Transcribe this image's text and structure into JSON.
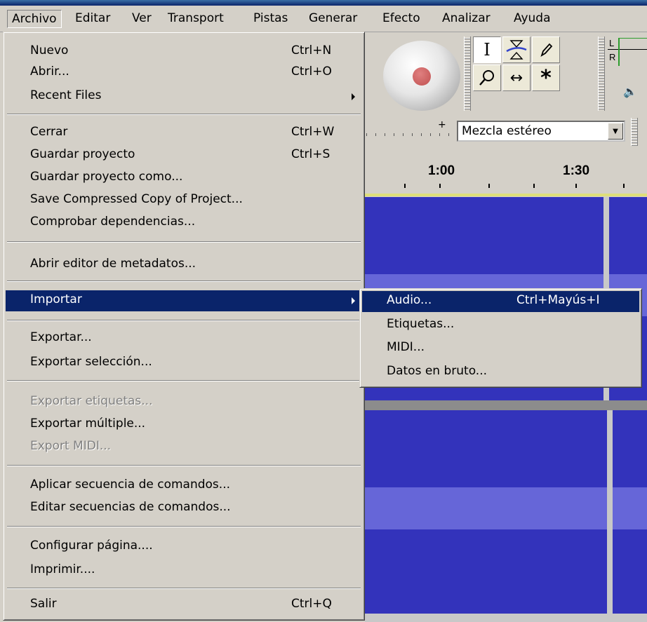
{
  "menubar": {
    "items": [
      "Archivo",
      "Editar",
      "Ver",
      "Transport",
      "Pistas",
      "Generar",
      "Efecto",
      "Analizar",
      "Ayuda"
    ]
  },
  "file_menu": {
    "items": [
      {
        "label": "Nuevo",
        "shortcut": "Ctrl+N"
      },
      {
        "label": "Abrir...",
        "shortcut": "Ctrl+O"
      },
      {
        "label": "Recent Files",
        "shortcut": ""
      },
      {
        "label": "Cerrar",
        "shortcut": "Ctrl+W"
      },
      {
        "label": "Guardar proyecto",
        "shortcut": "Ctrl+S"
      },
      {
        "label": "Guardar proyecto como...",
        "shortcut": ""
      },
      {
        "label": "Save Compressed Copy of Project...",
        "shortcut": ""
      },
      {
        "label": "Comprobar dependencias...",
        "shortcut": ""
      },
      {
        "label": "Abrir editor de metadatos...",
        "shortcut": ""
      },
      {
        "label": "Importar",
        "shortcut": ""
      },
      {
        "label": "Exportar...",
        "shortcut": ""
      },
      {
        "label": "Exportar selección...",
        "shortcut": ""
      },
      {
        "label": "Exportar etiquetas...",
        "shortcut": ""
      },
      {
        "label": "Exportar múltiple...",
        "shortcut": ""
      },
      {
        "label": "Export MIDI...",
        "shortcut": ""
      },
      {
        "label": "Aplicar secuencia de comandos...",
        "shortcut": ""
      },
      {
        "label": "Editar secuencias de comandos...",
        "shortcut": ""
      },
      {
        "label": "Configurar página....",
        "shortcut": ""
      },
      {
        "label": "Imprimir....",
        "shortcut": ""
      },
      {
        "label": "Salir",
        "shortcut": "Ctrl+Q"
      }
    ]
  },
  "import_submenu": {
    "items": [
      {
        "label": "Audio...",
        "shortcut": "Ctrl+Mayús+I"
      },
      {
        "label": "Etiquetas...",
        "shortcut": ""
      },
      {
        "label": "MIDI...",
        "shortcut": ""
      },
      {
        "label": "Datos en bruto...",
        "shortcut": ""
      }
    ]
  },
  "toolbar": {
    "meter_left": "L",
    "meter_right": "R",
    "input_source": "Mezcla estéreo"
  },
  "timeline": {
    "ticks": [
      "1:00",
      "1:30"
    ]
  },
  "colors": {
    "highlight": "#0a246a",
    "waveform": "#3333bb",
    "waveform_rms": "#6666d8",
    "menu_bg": "#d4d0c8"
  },
  "icons": {
    "select_tool": "ibeam-icon",
    "envelope_tool": "envelope-icon",
    "draw_tool": "pencil-icon",
    "zoom_tool": "magnifier-icon",
    "timeshift_tool": "double-arrow-icon",
    "multi_tool": "asterisk-icon",
    "record": "record-icon",
    "speaker": "speaker-icon"
  }
}
